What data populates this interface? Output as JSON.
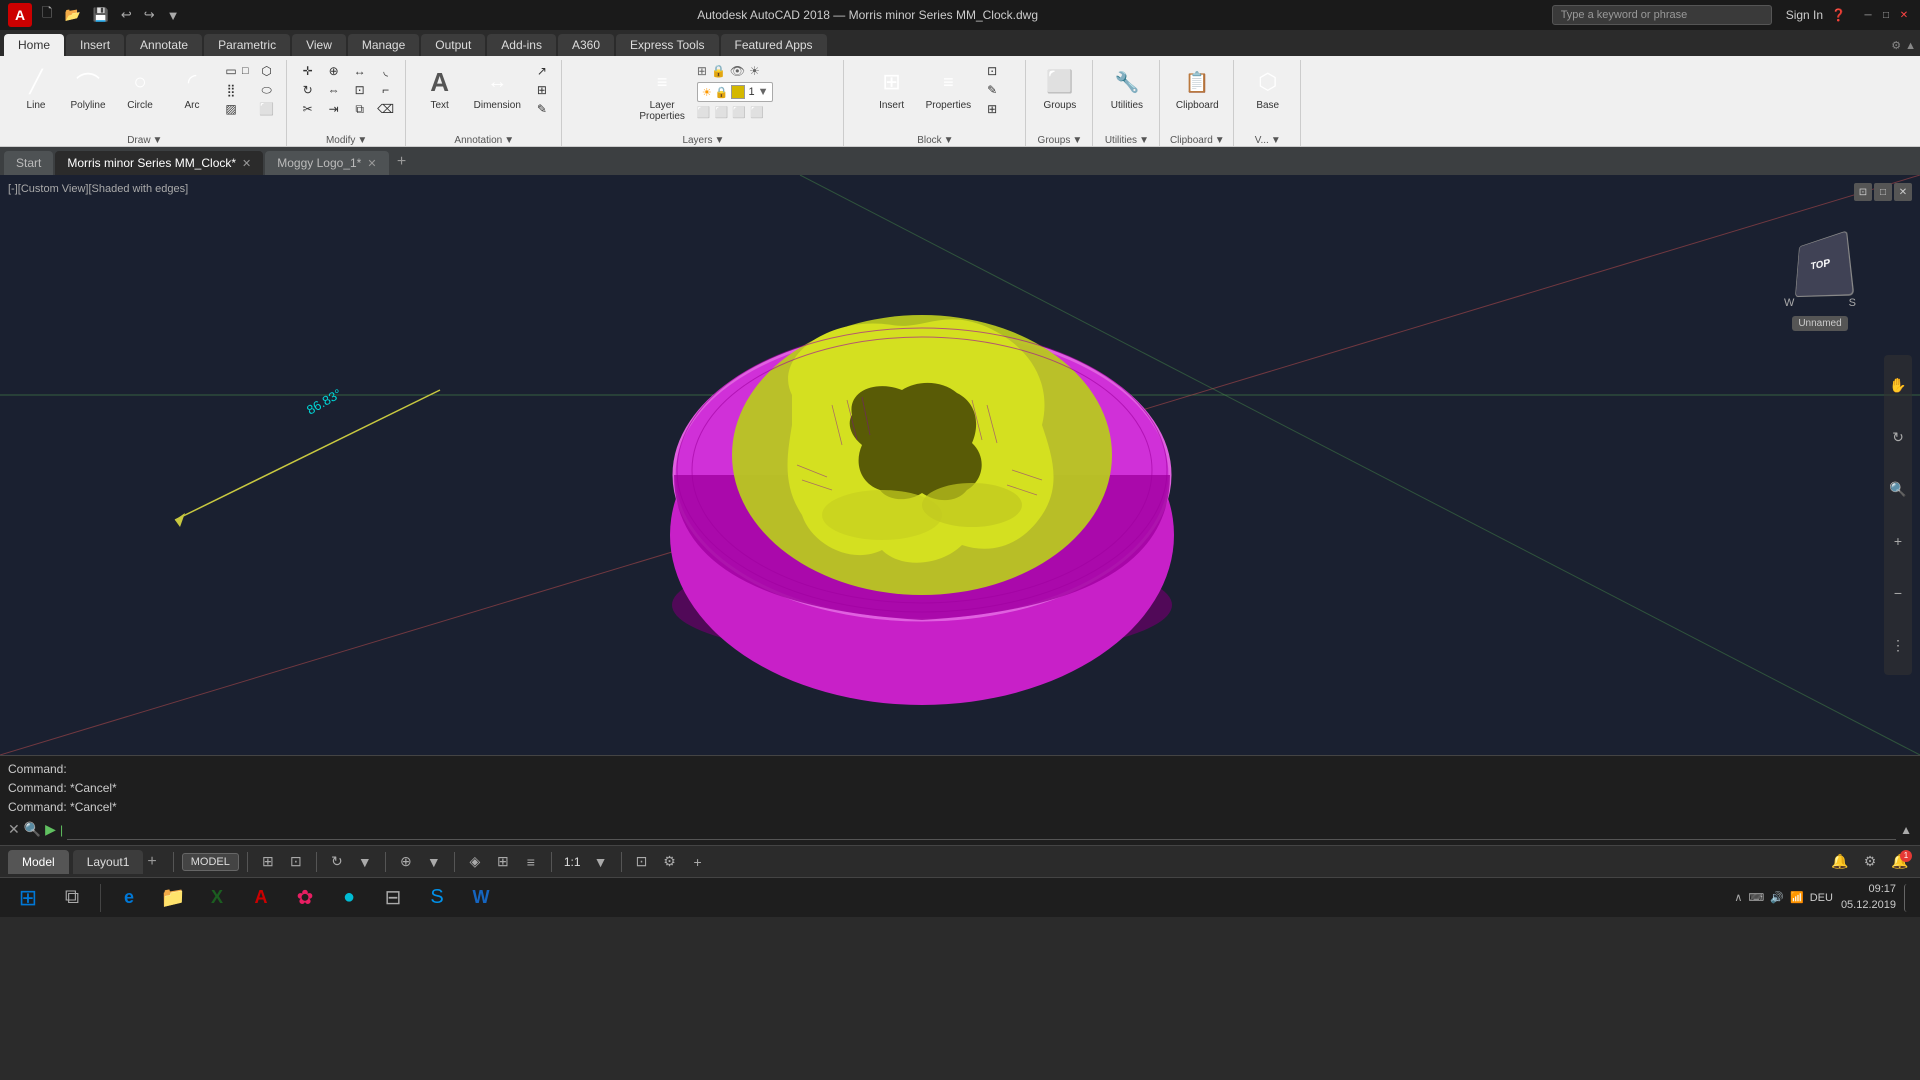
{
  "app": {
    "logo": "A",
    "title": "Autodesk AutoCAD 2018  —  Morris minor Series MM_Clock.dwg",
    "search_placeholder": "Type a keyword or phrase",
    "sign_in": "Sign In"
  },
  "quick_access": {
    "buttons": [
      "new",
      "open",
      "save",
      "saveas",
      "undo",
      "redo",
      "plot",
      "undo2"
    ]
  },
  "ribbon": {
    "tabs": [
      {
        "label": "Home",
        "active": true
      },
      {
        "label": "Insert",
        "active": false
      },
      {
        "label": "Annotate",
        "active": false
      },
      {
        "label": "Parametric",
        "active": false
      },
      {
        "label": "View",
        "active": false
      },
      {
        "label": "Manage",
        "active": false
      },
      {
        "label": "Output",
        "active": false
      },
      {
        "label": "Add-ins",
        "active": false
      },
      {
        "label": "A360",
        "active": false
      },
      {
        "label": "Express Tools",
        "active": false
      },
      {
        "label": "Featured Apps",
        "active": false
      }
    ],
    "groups": [
      {
        "name": "draw",
        "label": "Draw",
        "buttons": [
          {
            "id": "line",
            "label": "Line",
            "icon": "╱"
          },
          {
            "id": "polyline",
            "label": "Polyline",
            "icon": "⌒"
          },
          {
            "id": "circle",
            "label": "Circle",
            "icon": "○"
          },
          {
            "id": "arc",
            "label": "Arc",
            "icon": "◜"
          }
        ]
      },
      {
        "name": "modify",
        "label": "Modify"
      },
      {
        "name": "annotation",
        "label": "Annotation",
        "buttons": [
          {
            "id": "text",
            "label": "Text",
            "icon": "A"
          },
          {
            "id": "dimension",
            "label": "Dimension",
            "icon": "↔"
          }
        ]
      },
      {
        "name": "layers",
        "label": "Layers",
        "buttons": [
          {
            "id": "layer-properties",
            "label": "Layer\nProperties",
            "icon": "≡"
          }
        ],
        "layer_number": "1"
      },
      {
        "name": "block",
        "label": "Block",
        "buttons": [
          {
            "id": "insert",
            "label": "Insert",
            "icon": "⊞"
          },
          {
            "id": "properties",
            "label": "Properties",
            "icon": "≡"
          }
        ]
      },
      {
        "name": "groups",
        "label": "Groups",
        "buttons": [
          {
            "id": "groups",
            "label": "Groups",
            "icon": "⬜"
          }
        ]
      },
      {
        "name": "utilities",
        "label": "Utilities",
        "buttons": [
          {
            "id": "utilities",
            "label": "Utilities",
            "icon": "🔧"
          }
        ]
      },
      {
        "name": "clipboard",
        "label": "Clipboard",
        "buttons": [
          {
            "id": "clipboard",
            "label": "Clipboard",
            "icon": "📋"
          }
        ]
      },
      {
        "name": "base",
        "label": "Base",
        "buttons": [
          {
            "id": "base",
            "label": "Base",
            "icon": "⬡"
          }
        ]
      }
    ]
  },
  "doc_tabs": [
    {
      "label": "Start",
      "active": false,
      "closeable": false
    },
    {
      "label": "Morris minor Series MM_Clock*",
      "active": true,
      "closeable": true
    },
    {
      "label": "Moggy Logo_1*",
      "active": false,
      "closeable": true
    }
  ],
  "viewport": {
    "view_label": "[-][Custom View][Shaded with edges]",
    "navcube_label": "TOP",
    "navcube_tag": "Unnamed",
    "compass": {
      "W": "W",
      "S": "S"
    },
    "dimension_text": "86.83°"
  },
  "command_line": {
    "history": [
      "Command: ",
      "Command: *Cancel*",
      "Command: *Cancel*"
    ],
    "prompt_placeholder": ""
  },
  "statusbar": {
    "model_tabs": [
      {
        "label": "Model",
        "active": true
      },
      {
        "label": "Layout1",
        "active": false
      }
    ],
    "model_btn": "MODEL",
    "zoom": "1:1"
  },
  "taskbar": {
    "items": [
      {
        "id": "start",
        "icon": "⊞",
        "color": "#0078d7"
      },
      {
        "id": "task-view",
        "icon": "⧉"
      },
      {
        "id": "edge",
        "icon": "e",
        "color": "#0078d7"
      },
      {
        "id": "explorer",
        "icon": "📁",
        "color": "#f9a825"
      },
      {
        "id": "excel",
        "icon": "X",
        "color": "#1b5e20"
      },
      {
        "id": "autocad",
        "icon": "A",
        "color": "#c00"
      },
      {
        "id": "task5",
        "icon": "✿"
      },
      {
        "id": "task6",
        "icon": "●",
        "color": "#00bcd4"
      },
      {
        "id": "calc",
        "icon": "⊟"
      },
      {
        "id": "skype",
        "icon": "S",
        "color": "#0091ea"
      },
      {
        "id": "word",
        "icon": "W",
        "color": "#1565c0"
      }
    ],
    "sys_tray": {
      "time": "09:17",
      "date": "05.12.2019"
    },
    "notification_count": "1"
  }
}
